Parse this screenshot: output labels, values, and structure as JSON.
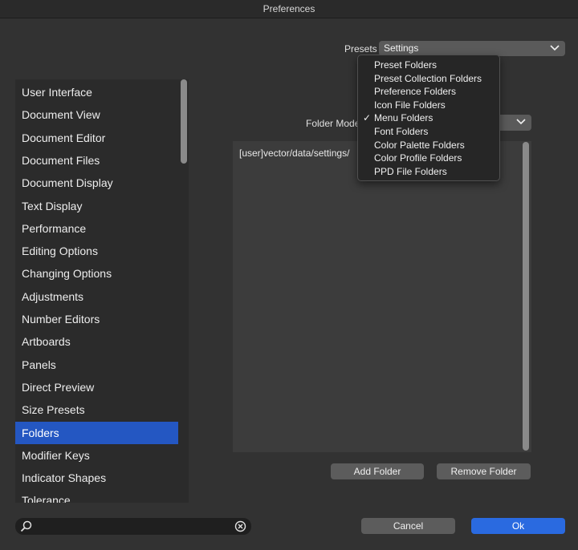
{
  "window": {
    "title": "Preferences"
  },
  "presets": {
    "label": "Presets",
    "value": "Settings"
  },
  "folder_mode": {
    "label": "Folder Mode"
  },
  "dropdown": {
    "options": [
      "Preset Folders",
      "Preset Collection Folders",
      "Preference Folders",
      "Icon File Folders",
      "Menu Folders",
      "Font Folders",
      "Color Palette Folders",
      "Color Profile Folders",
      "PPD File Folders"
    ],
    "checkmark": "✓",
    "selected_option": "Menu Folders"
  },
  "sidebar": {
    "items": [
      "User Interface",
      "Document View",
      "Document Editor",
      "Document Files",
      "Document Display",
      "Text Display",
      "Performance",
      "Editing Options",
      "Changing Options",
      "Adjustments",
      "Number Editors",
      "Artboards",
      "Panels",
      "Direct Preview",
      "Size Presets",
      "Folders",
      "Modifier Keys",
      "Indicator Shapes",
      "Tolerance"
    ],
    "selected": "Folders"
  },
  "folders": {
    "paths": [
      "[user]vector/data/settings/"
    ]
  },
  "buttons": {
    "add_folder": "Add Folder",
    "remove_folder": "Remove Folder",
    "cancel": "Cancel",
    "ok": "Ok"
  },
  "search": {
    "value": ""
  },
  "icons": {
    "search": "search-icon",
    "clear": "clear-search-icon",
    "chevron": "chevron-down-icon",
    "check": "checkmark-icon"
  },
  "colors": {
    "accent": "#2457c2",
    "primary_button": "#2a6ae0"
  }
}
